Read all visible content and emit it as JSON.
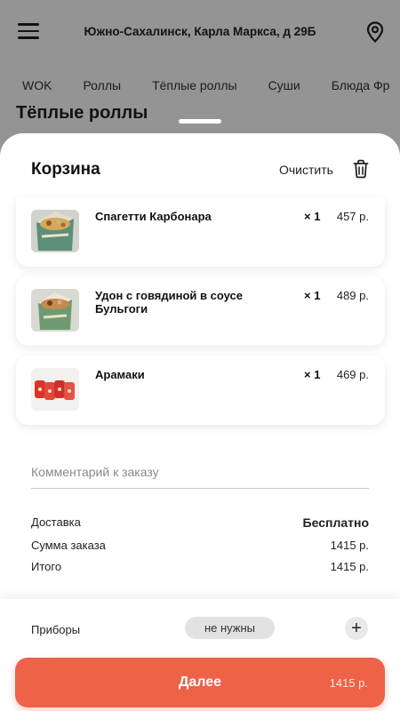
{
  "header": {
    "address": "Южно-Сахалинск, Карла Маркса, д 29Б"
  },
  "categories": [
    "WOK",
    "Роллы",
    "Тёплые роллы",
    "Суши",
    "Блюда Фр"
  ],
  "section_title": "Тёплые роллы",
  "cart": {
    "title": "Корзина",
    "clear_label": "Очистить",
    "items": [
      {
        "name": "Спагетти Карбонара",
        "qty": "× 1",
        "price": "457 р."
      },
      {
        "name": "Удон с говядиной в соусе Бульгоги",
        "qty": "× 1",
        "price": "489 р."
      },
      {
        "name": "Арамаки",
        "qty": "× 1",
        "price": "469 р."
      }
    ],
    "comment_placeholder": "Комментарий к заказу",
    "summary": {
      "delivery_label": "Доставка",
      "delivery_value": "Бесплатно",
      "order_sum_label": "Сумма заказа",
      "order_sum_value": "1415 р.",
      "total_label": "Итого",
      "total_value": "1415 р."
    },
    "cutlery": {
      "label": "Приборы",
      "value": "не нужны",
      "plus": "+"
    },
    "next_button": {
      "label": "Далее",
      "price": "1415 р."
    }
  },
  "colors": {
    "accent": "#ee6248",
    "overlay": "rgba(0,0,0,0.42)"
  }
}
